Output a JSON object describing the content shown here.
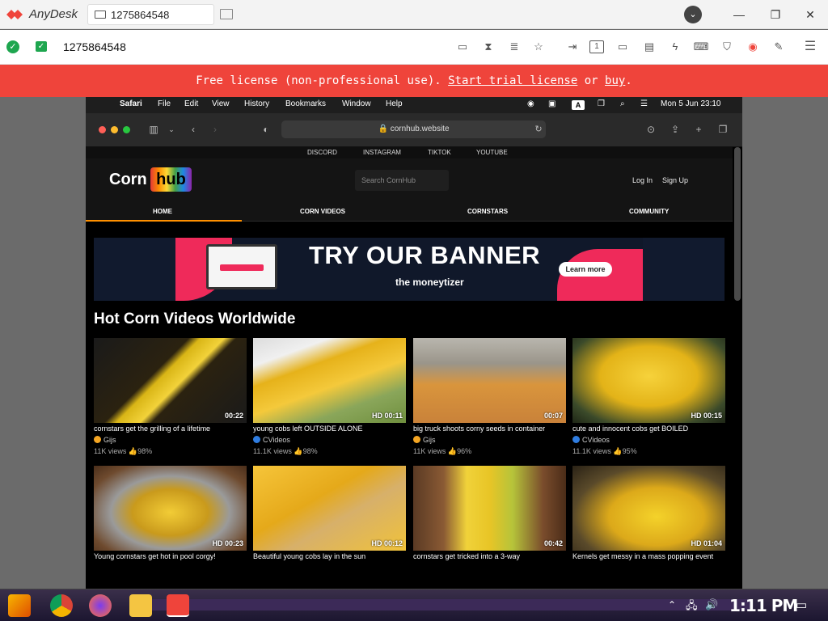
{
  "anydesk": {
    "app_name": "AnyDesk",
    "tab_address": "1275864548",
    "address_field": "1275864548",
    "menu_icon": "chevron-down-icon",
    "license_text_prefix": "Free license (non-professional use).",
    "license_link_trial": "Start trial license",
    "license_or": "or",
    "license_link_buy": "buy",
    "license_period": ".",
    "brand_color": "#ef443b"
  },
  "mac": {
    "menu": [
      "Safari",
      "File",
      "Edit",
      "View",
      "History",
      "Bookmarks",
      "Window",
      "Help"
    ],
    "clock": "Mon 5 Jun  23:10",
    "input_indicator": "A"
  },
  "safari": {
    "url": "cornhub.website"
  },
  "site": {
    "social": [
      "DISCORD",
      "INSTAGRAM",
      "TIKTOK",
      "YOUTUBE"
    ],
    "logo_left": "Corn",
    "logo_right": "hub",
    "search_placeholder": "Search CornHub",
    "login": "Log In",
    "signup": "Sign Up",
    "nav": [
      "HOME",
      "CORN VIDEOS",
      "CORNSTARS",
      "COMMUNITY"
    ],
    "accent": "#ff9000",
    "banner": {
      "headline": "TRY OUR BANNER",
      "button": "Learn more",
      "brand": "the moneytizer"
    },
    "section_title": "Hot Corn Videos Worldwide",
    "videos": [
      {
        "title": "cornstars get the grilling of a lifetime",
        "duration": "00:22",
        "user": "Gijs",
        "views": "11K views",
        "rating": "98%",
        "user_color": "#f5a623"
      },
      {
        "title": "young cobs left OUTSIDE ALONE",
        "duration": "HD 00:11",
        "user": "CVideos",
        "views": "11.1K views",
        "rating": "98%",
        "user_color": "#2f7de1"
      },
      {
        "title": "big truck shoots corny seeds in container",
        "duration": "00:07",
        "user": "Gijs",
        "views": "11K views",
        "rating": "96%",
        "user_color": "#f5a623"
      },
      {
        "title": "cute and innocent cobs get BOILED",
        "duration": "HD 00:15",
        "user": "CVideos",
        "views": "11.1K views",
        "rating": "95%",
        "user_color": "#2f7de1"
      },
      {
        "title": "Young cornstars get hot in pool corgy!",
        "duration": "HD 00:23",
        "user": "",
        "views": "",
        "rating": "",
        "user_color": ""
      },
      {
        "title": "Beautiful young cobs lay in the sun",
        "duration": "HD 00:12",
        "user": "",
        "views": "",
        "rating": "",
        "user_color": ""
      },
      {
        "title": "cornstars get tricked into a 3-way",
        "duration": "00:42",
        "user": "",
        "views": "",
        "rating": "",
        "user_color": ""
      },
      {
        "title": "Kernels get messy in a mass popping event",
        "duration": "HD 01:04",
        "user": "",
        "views": "",
        "rating": "",
        "user_color": ""
      }
    ]
  },
  "taskbar": {
    "clock": "1:11 PM"
  }
}
